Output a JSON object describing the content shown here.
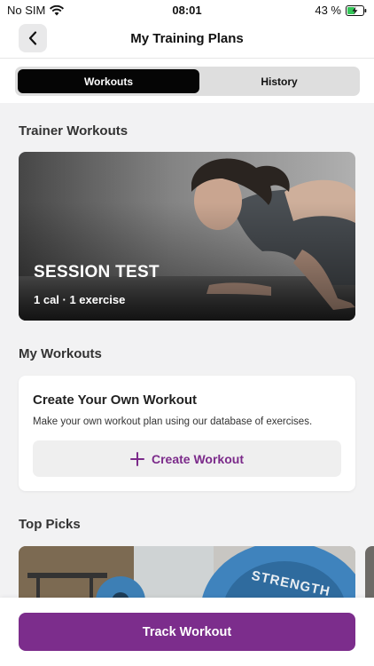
{
  "status_bar": {
    "carrier": "No SIM",
    "time": "08:01",
    "battery": "43 %"
  },
  "nav": {
    "title": "My Training Plans",
    "back_icon": "chevron-left-icon"
  },
  "tabs": [
    {
      "label": "Workouts",
      "active": true
    },
    {
      "label": "History",
      "active": false
    }
  ],
  "sections": {
    "trainer_workouts": "Trainer Workouts",
    "my_workouts": "My Workouts",
    "top_picks": "Top Picks"
  },
  "trainer_card": {
    "title": "SESSION TEST",
    "meta": "1 cal · 1 exercise"
  },
  "create_card": {
    "title": "Create Your Own Workout",
    "description": "Make your own workout plan using our database of exercises.",
    "button_label": "Create Workout",
    "button_icon": "plus-icon"
  },
  "top_pick_image_text": "STRENGTH",
  "bottom_bar": {
    "button_label": "Track Workout"
  },
  "colors": {
    "accent": "#7c2d8c",
    "accent_text": "#7b2a8a",
    "tab_active_bg": "#050505",
    "background": "#f2f2f3"
  }
}
